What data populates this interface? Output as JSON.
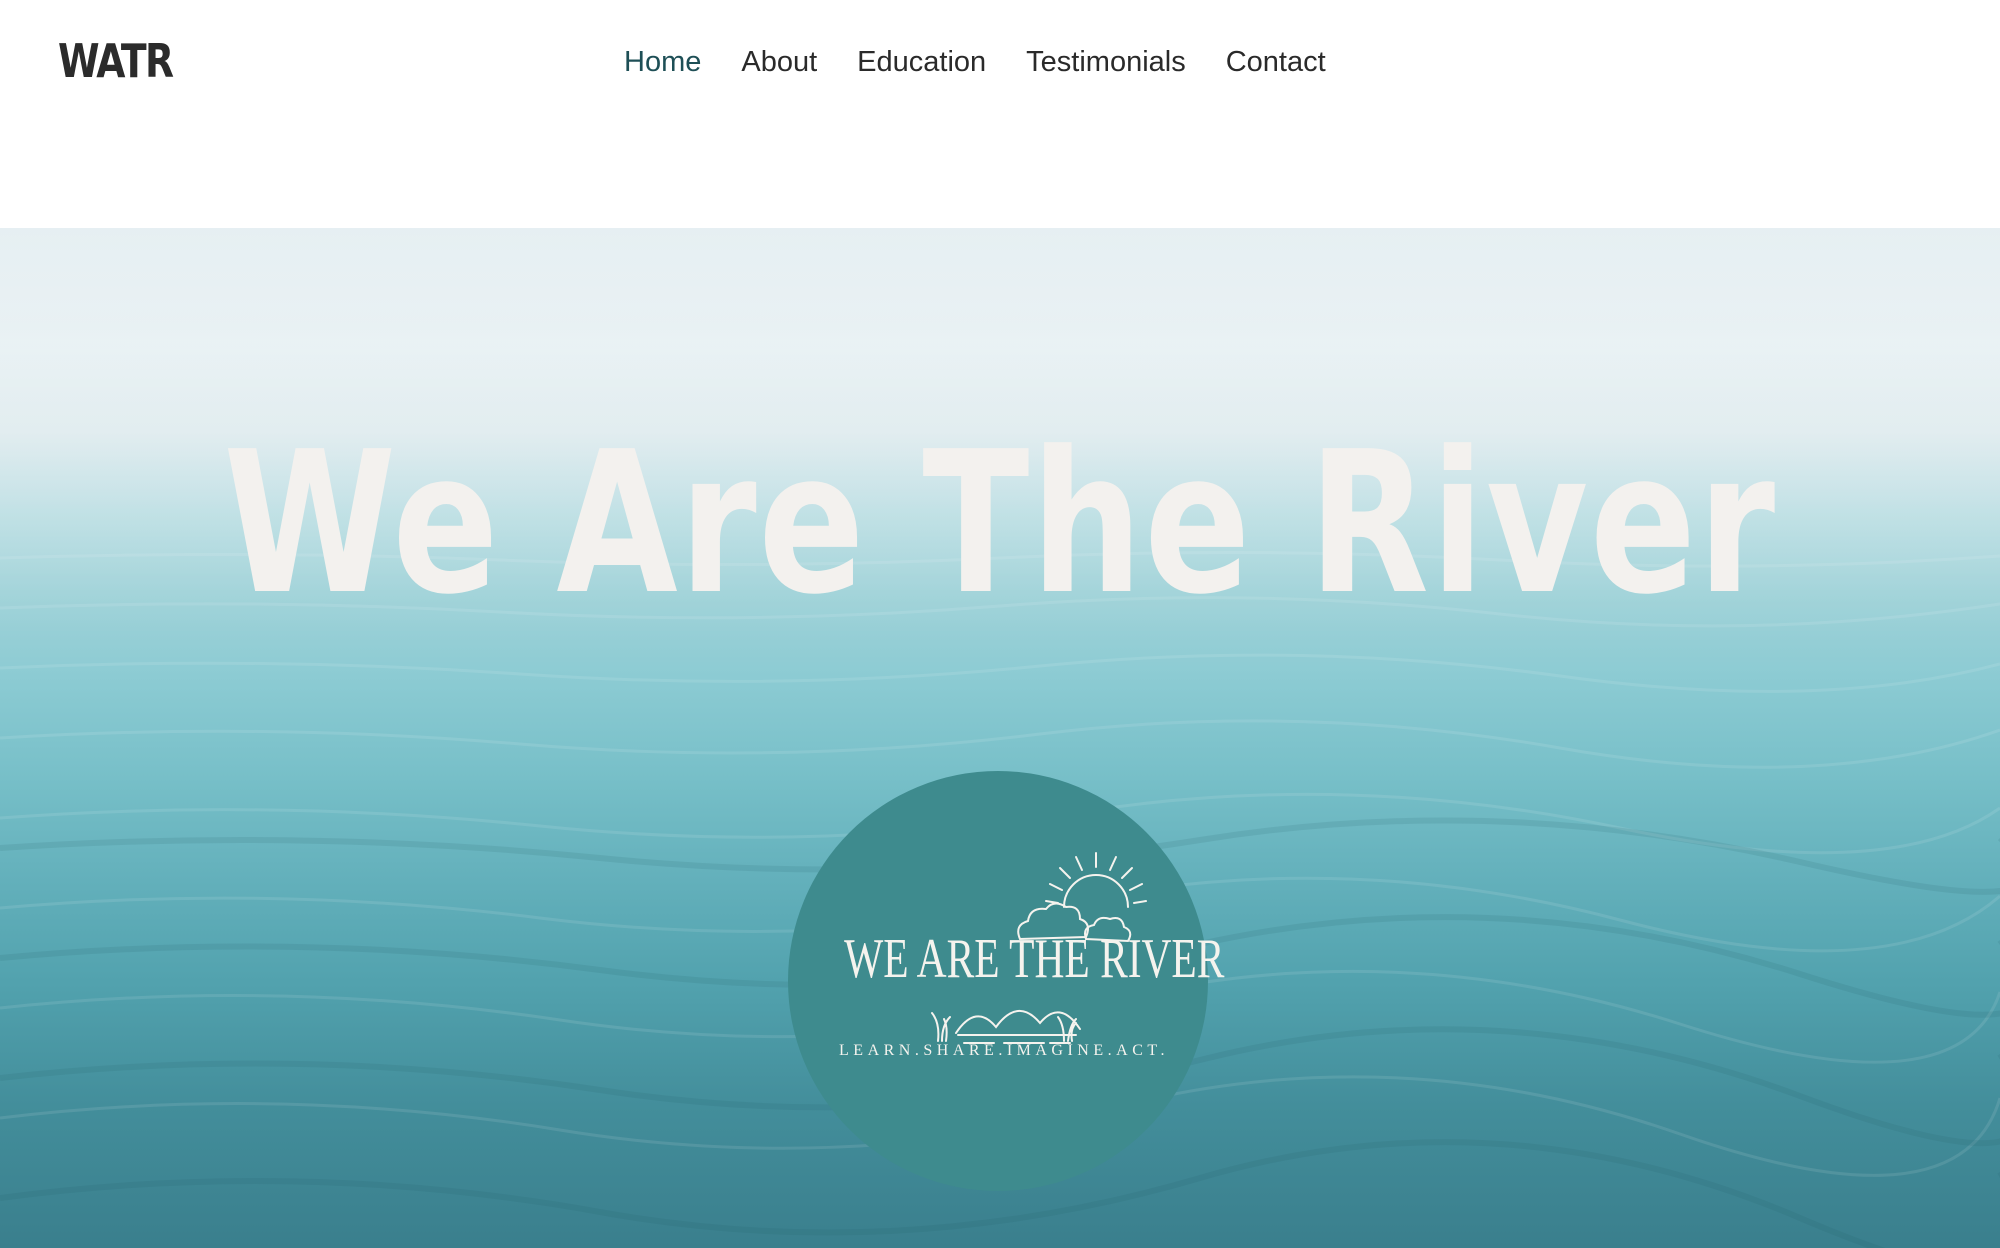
{
  "header": {
    "logo": "WATR",
    "nav": [
      {
        "label": "Home",
        "active": true
      },
      {
        "label": "About",
        "active": false
      },
      {
        "label": "Education",
        "active": false
      },
      {
        "label": "Testimonials",
        "active": false
      },
      {
        "label": "Contact",
        "active": false
      }
    ]
  },
  "hero": {
    "title": "We Are The River",
    "badge": {
      "title": "WE ARE THE RIVER",
      "tagline": "LEARN.SHARE.IMAGINE.ACT."
    }
  },
  "colors": {
    "nav_active": "#1e4f56",
    "badge_bg": "#3e8b8e",
    "hero_title": "#f3f1ee"
  }
}
